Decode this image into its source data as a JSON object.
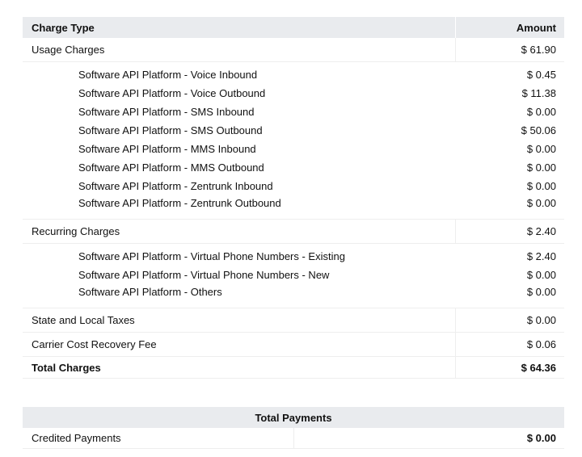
{
  "charges": {
    "header": {
      "type": "Charge Type",
      "amount": "Amount"
    },
    "groups": [
      {
        "label": "Usage Charges",
        "amount": "$ 61.90",
        "items": [
          {
            "label": "Software API Platform - Voice Inbound",
            "amount": "$ 0.45"
          },
          {
            "label": "Software API Platform - Voice Outbound",
            "amount": "$ 11.38"
          },
          {
            "label": "Software API Platform - SMS Inbound",
            "amount": "$ 0.00"
          },
          {
            "label": "Software API Platform - SMS Outbound",
            "amount": "$ 50.06"
          },
          {
            "label": "Software API Platform - MMS Inbound",
            "amount": "$ 0.00"
          },
          {
            "label": "Software API Platform - MMS Outbound",
            "amount": "$ 0.00"
          },
          {
            "label": "Software API Platform - Zentrunk Inbound",
            "amount": "$ 0.00"
          },
          {
            "label": "Software API Platform - Zentrunk Outbound",
            "amount": "$ 0.00"
          }
        ]
      },
      {
        "label": "Recurring Charges",
        "amount": "$ 2.40",
        "items": [
          {
            "label": "Software API Platform - Virtual Phone Numbers - Existing",
            "amount": "$ 2.40"
          },
          {
            "label": "Software API Platform - Virtual Phone Numbers - New",
            "amount": "$ 0.00"
          },
          {
            "label": "Software API Platform - Others",
            "amount": "$ 0.00"
          }
        ]
      }
    ],
    "others": [
      {
        "label": "State and Local Taxes",
        "amount": "$ 0.00"
      },
      {
        "label": "Carrier Cost Recovery Fee",
        "amount": "$ 0.06"
      }
    ],
    "total": {
      "label": "Total Charges",
      "amount": "$ 64.36"
    }
  },
  "payments": {
    "header": "Total Payments",
    "rows": [
      {
        "label": "Credited Payments",
        "amount": "$ 0.00"
      }
    ]
  }
}
